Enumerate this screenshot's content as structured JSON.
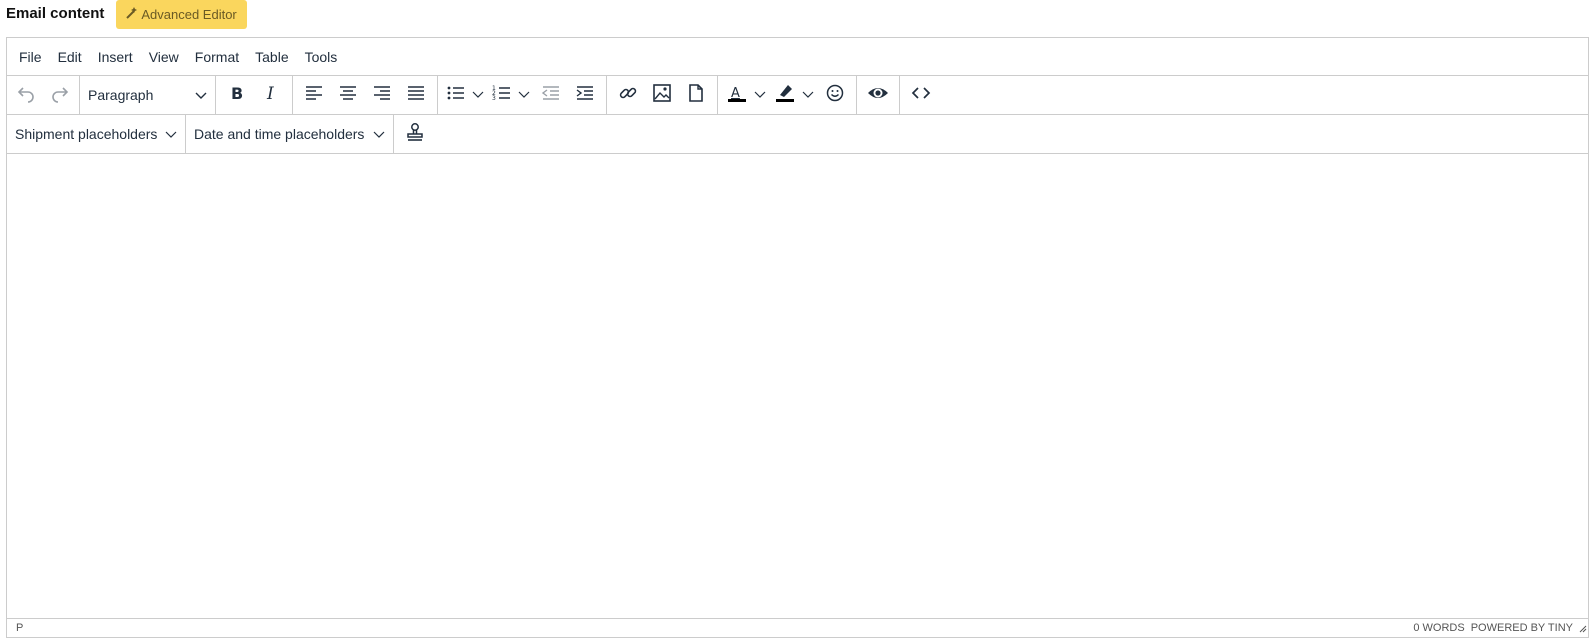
{
  "header": {
    "title": "Email content",
    "advanced_editor_label": "Advanced Editor"
  },
  "menubar": {
    "items": [
      "File",
      "Edit",
      "Insert",
      "View",
      "Format",
      "Table",
      "Tools"
    ]
  },
  "toolbar": {
    "block_format": "Paragraph"
  },
  "toolbar2": {
    "shipment_placeholders": "Shipment placeholders",
    "datetime_placeholders": "Date and time placeholders"
  },
  "statusbar": {
    "path": "P",
    "word_count": "0 WORDS",
    "powered_by": "POWERED BY TINY"
  },
  "colors": {
    "accent": "#fad65d",
    "text": "#222f3e",
    "border": "#cccccc"
  }
}
